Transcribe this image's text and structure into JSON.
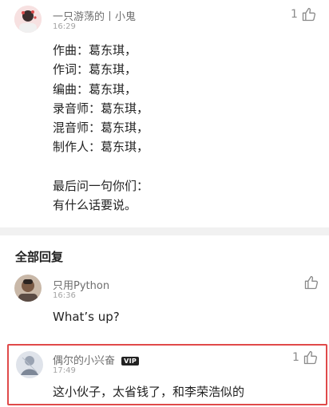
{
  "top_comment": {
    "author": "一只游荡的丨小鬼",
    "time": "16:29",
    "like_count": "1",
    "lines": [
      "作曲：葛东琪，",
      "作词：葛东琪，",
      "编曲：葛东琪，",
      "录音师：葛东琪，",
      "混音师：葛东琪，",
      "制作人：葛东琪，",
      "",
      "最后问一句你们：",
      "有什么话要说。"
    ]
  },
  "section": {
    "title": "全部回复"
  },
  "replies": [
    {
      "author": "只用Python",
      "time": "16:36",
      "text": "What’s up?",
      "like_count": ""
    },
    {
      "author": "偶尔的小兴奋",
      "badge": "VIP",
      "time": "17:49",
      "text": "这小伙子，太省钱了，和李荣浩似的",
      "like_count": "1"
    }
  ],
  "colors": {
    "highlight_border": "#e04a4a",
    "divider": "#f1f1f1"
  },
  "icons": [
    "avatar",
    "thumbs-up-icon",
    "vip-badge-icon"
  ]
}
